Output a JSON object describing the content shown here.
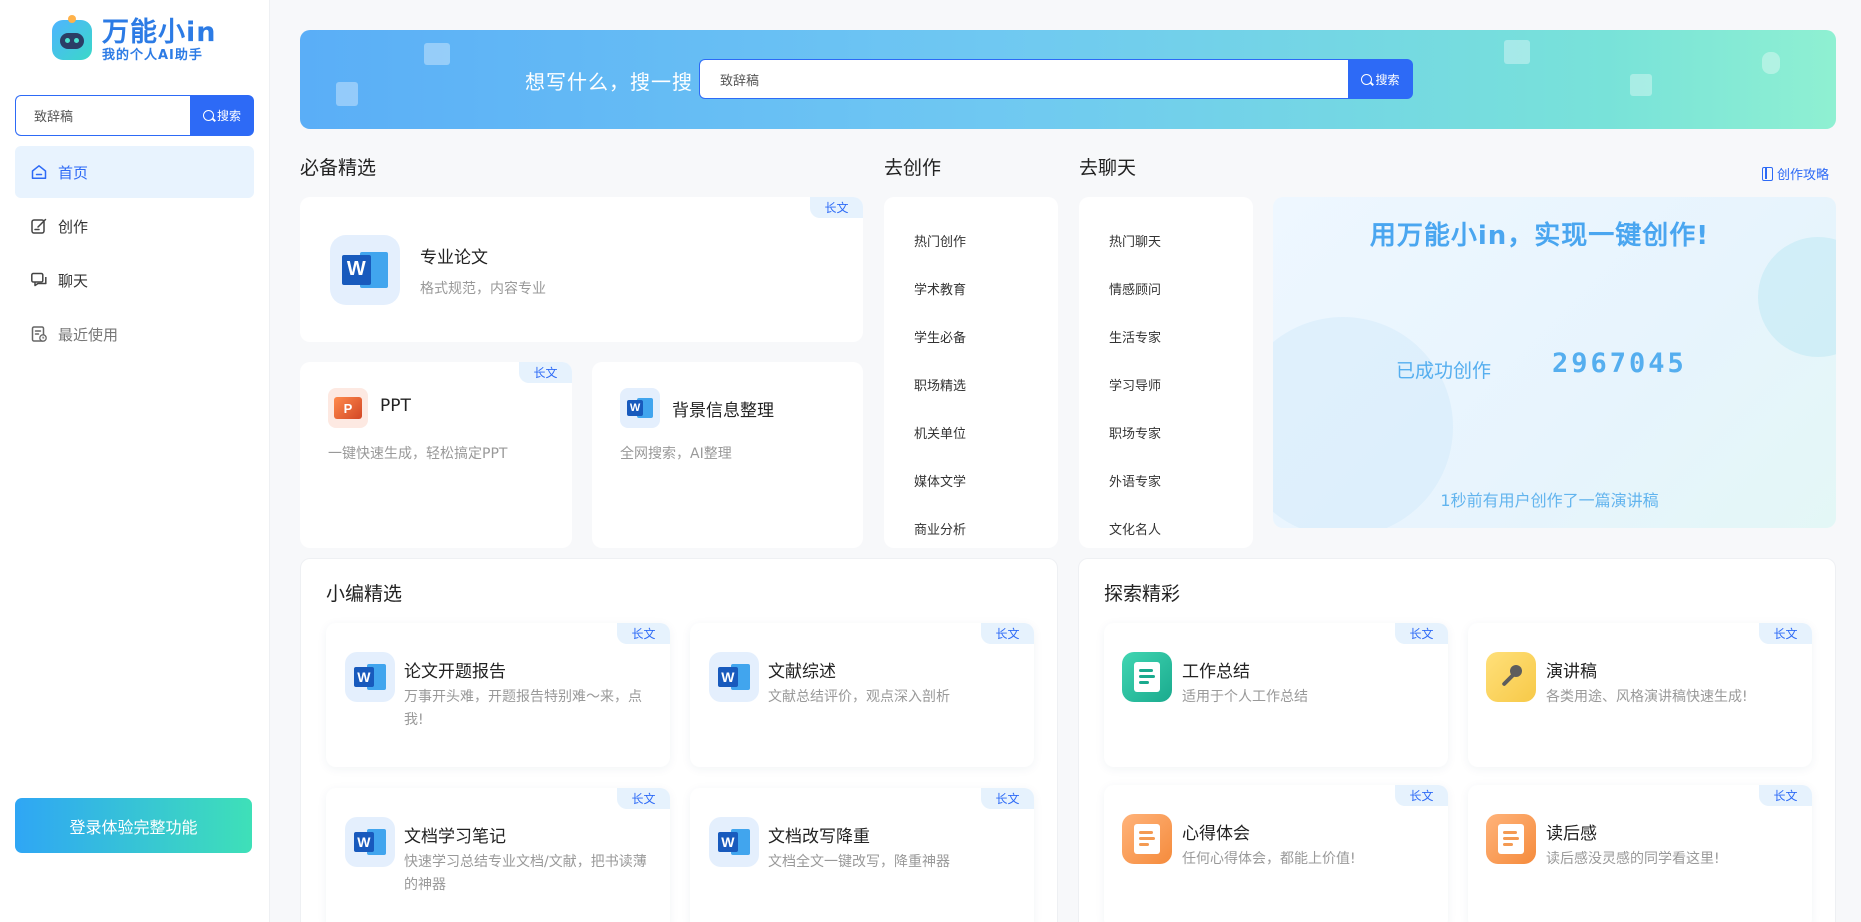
{
  "sidebar": {
    "logo_title": "万能小in",
    "logo_sub": "我的个人AI助手",
    "search_value": "致辞稿",
    "search_button": "搜索",
    "nav": [
      {
        "label": "首页"
      },
      {
        "label": "创作"
      },
      {
        "label": "聊天"
      },
      {
        "label": "最近使用"
      }
    ],
    "login_label": "登录体验完整功能"
  },
  "banner": {
    "label": "想写什么，搜一搜",
    "search_value": "致辞稿",
    "search_button": "搜索"
  },
  "sections": {
    "essentials": "必备精选",
    "create": "去创作",
    "chat": "去聊天",
    "guide_link": "创作攻略",
    "editor_picks": "小编精选",
    "explore": "探索精彩"
  },
  "essentials": {
    "main": {
      "title": "专业论文",
      "desc": "格式规范，内容专业",
      "tag": "长文"
    },
    "ppt": {
      "title": "PPT",
      "desc": "一键快速生成，轻松搞定PPT",
      "tag": "长文"
    },
    "bg": {
      "title": "背景信息整理",
      "desc": "全网搜索，AI整理"
    }
  },
  "create_list": [
    "热门创作",
    "学术教育",
    "学生必备",
    "职场精选",
    "机关单位",
    "媒体文学",
    "商业分析"
  ],
  "chat_list": [
    "热门聊天",
    "情感顾问",
    "生活专家",
    "学习导师",
    "职场专家",
    "外语专家",
    "文化名人"
  ],
  "promo": {
    "title": "用万能小in，实现一键创作!",
    "count_label": "已成功创作",
    "count": "2967045",
    "footer": "1秒前有用户创作了一篇演讲稿"
  },
  "editor_picks": [
    {
      "title": "论文开题报告",
      "desc": "万事开头难，开题报告特别难～来，点我!",
      "tag": "长文"
    },
    {
      "title": "文献综述",
      "desc": "文献总结评价，观点深入剖析",
      "tag": "长文"
    },
    {
      "title": "文档学习笔记",
      "desc": "快速学习总结专业文档/文献，把书读薄的神器",
      "tag": "长文"
    },
    {
      "title": "文档改写降重",
      "desc": "文档全文一键改写，降重神器",
      "tag": "长文"
    }
  ],
  "explore": [
    {
      "title": "工作总结",
      "desc": "适用于个人工作总结",
      "tag": "长文",
      "icon": "work-summary-icon"
    },
    {
      "title": "演讲稿",
      "desc": "各类用途、风格演讲稿快速生成!",
      "tag": "长文",
      "icon": "microphone-icon"
    },
    {
      "title": "心得体会",
      "desc": "任何心得体会，都能上价值!",
      "tag": "长文",
      "icon": "notes-icon"
    },
    {
      "title": "读后感",
      "desc": "读后感没灵感的同学看这里!",
      "tag": "长文",
      "icon": "notes-icon"
    }
  ],
  "colors": {
    "brand": "#2d6af6",
    "active_bg": "#e8f3fe",
    "promo_text": "#4aa6f0"
  }
}
